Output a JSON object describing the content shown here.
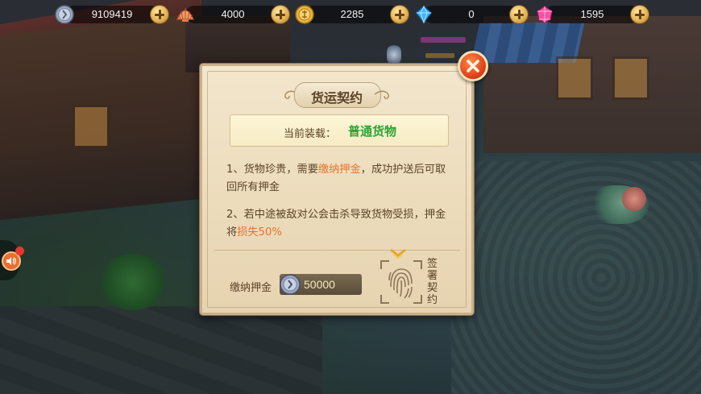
{
  "resources": [
    {
      "name": "silver-coin",
      "value": "9109419",
      "icon": "silver-coin-icon"
    },
    {
      "name": "shell",
      "value": "4000",
      "icon": "shell-icon"
    },
    {
      "name": "gold-coin",
      "value": "2285",
      "icon": "gold-coin-icon"
    },
    {
      "name": "diamond",
      "value": "0",
      "icon": "blue-diamond-icon"
    },
    {
      "name": "gem",
      "value": "1595",
      "icon": "pink-gem-icon"
    }
  ],
  "dialog": {
    "title": "货运契约",
    "cargo_label": "当前装载：",
    "cargo_value": "普通货物",
    "rule1": {
      "pre": "1、货物珍贵，需要",
      "highlight": "缴纳押金",
      "post": "，成功护送后可取回所有押金"
    },
    "rule2": {
      "pre": "2、若中途被敌对公会击杀导致货物受损，押金将",
      "highlight": "损失50%",
      "post": ""
    },
    "deposit_label": "缴纳押金",
    "deposit_value": "50000",
    "sign_label": "签署契约"
  },
  "colors": {
    "highlight": "#e6732b",
    "cargo_green": "#2ea232",
    "text_brown": "#5b4328",
    "close_red": "#e1461d"
  }
}
